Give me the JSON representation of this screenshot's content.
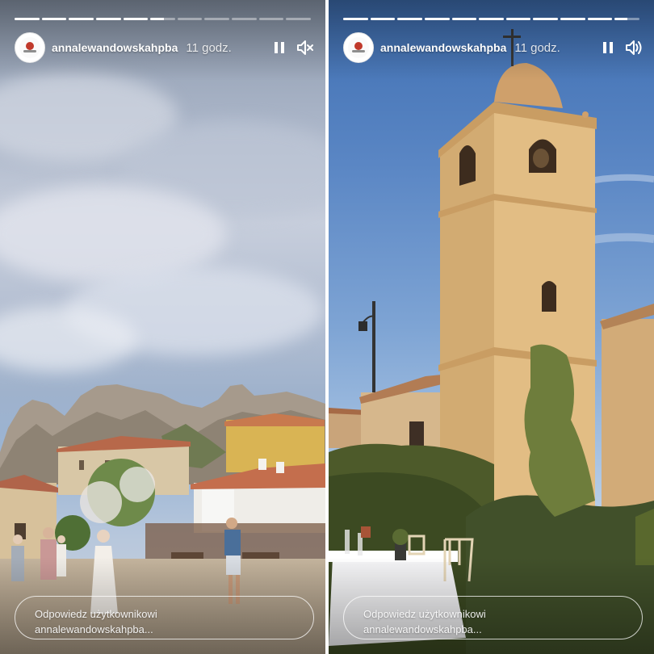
{
  "stories": [
    {
      "id": "left",
      "username": "annalewandowskahpba",
      "time": "11 godz.",
      "sound": "muted",
      "progress_segments": 11,
      "active_segment": 6,
      "reply_placeholder_line1": "Odpowiedz użytkownikowi",
      "reply_placeholder_line2": "annalewandowskahpba..."
    },
    {
      "id": "right",
      "username": "annalewandowskahpba",
      "time": "11 godz.",
      "sound": "on",
      "progress_segments": 11,
      "active_segment": 11,
      "reply_placeholder_line1": "Odpowiedz użytkownikowi",
      "reply_placeholder_line2": "annalewandowskahpba..."
    }
  ],
  "icons": {
    "pause": "pause-icon",
    "mute": "speaker-muted-icon",
    "sound": "speaker-on-icon"
  },
  "colors": {
    "ui_text": "#ffffff",
    "sky_left": "#a9b4c7",
    "sky_right": "#5a86c4",
    "stone": "#c8a878"
  }
}
